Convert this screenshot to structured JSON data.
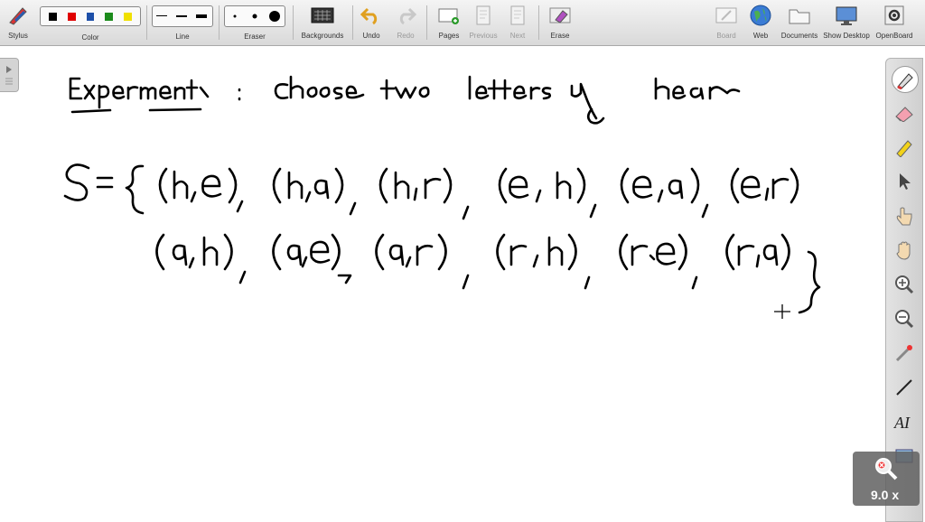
{
  "toolbar": {
    "stylus": "Stylus",
    "color": "Color",
    "line": "Line",
    "eraser": "Eraser",
    "backgrounds": "Backgrounds",
    "undo": "Undo",
    "redo": "Redo",
    "pages": "Pages",
    "previous": "Previous",
    "next": "Next",
    "erase": "Erase",
    "board": "Board",
    "web": "Web",
    "documents": "Documents",
    "show_desktop": "Show Desktop",
    "openboard": "OpenBoard"
  },
  "colors": [
    "#000000",
    "#e00000",
    "#1d4fa8",
    "#1b8a1b",
    "#f0e000"
  ],
  "zoom": {
    "value": "9.0 x"
  }
}
